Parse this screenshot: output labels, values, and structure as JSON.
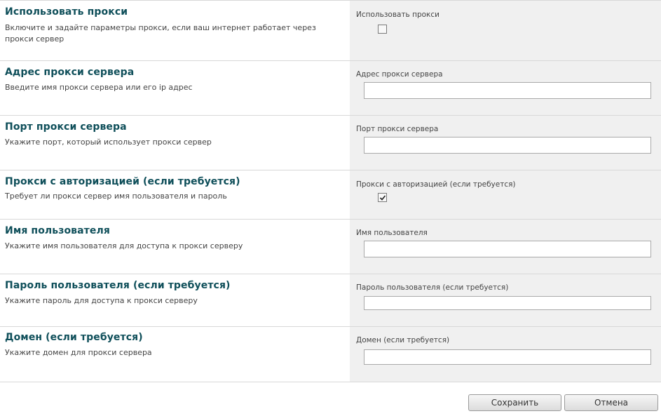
{
  "fields": [
    {
      "title": "Использовать прокси",
      "help": "Включите и задайте параметры прокси, если ваш интернет работает через прокси сервер",
      "label": "Использовать прокси",
      "type": "checkbox",
      "checked": false
    },
    {
      "title": "Адрес прокси сервера",
      "help": "Введите имя прокси сервера или его ip адрес",
      "label": "Адрес прокси сервера",
      "type": "text",
      "value": ""
    },
    {
      "title": "Порт прокси сервера",
      "help": "Укажите порт, который использует прокси сервер",
      "label": "Порт прокси сервера",
      "type": "text",
      "value": ""
    },
    {
      "title": "Прокси с авторизацией (если требуется)",
      "help": "Требует ли прокси сервер имя пользователя и пароль",
      "label": "Прокси с авторизацией (если требуется)",
      "type": "checkbox",
      "checked": true
    },
    {
      "title": "Имя пользователя",
      "help": "Укажите имя пользователя для доступа к прокси серверу",
      "label": "Имя пользователя",
      "type": "text",
      "value": ""
    },
    {
      "title": "Пароль пользователя (если требуется)",
      "help": "Укажите пароль для доступа к прокси серверу",
      "label": "Пароль пользователя (если требуется)",
      "type": "text",
      "value": ""
    },
    {
      "title": "Домен (если требуется)",
      "help": "Укажите домен для прокси сервера",
      "label": "Домен (если требуется)",
      "type": "text",
      "value": ""
    }
  ],
  "buttons": {
    "save": "Сохранить",
    "cancel": "Отмена"
  },
  "colors": {
    "title": "#0f4f5a",
    "control_panel_bg": "#f0f0f0"
  }
}
